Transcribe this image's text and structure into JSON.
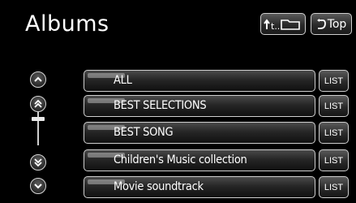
{
  "header": {
    "title": "Albums",
    "folder_button_icon": "folder-up-icon",
    "folder_button_label": "t..",
    "top_button_label": "Top",
    "top_button_icon": "return-arrow-icon"
  },
  "scroll": {
    "page_up_icon": "double-chevron-up-icon",
    "line_up_icon": "chevron-up-icon",
    "line_down_icon": "chevron-down-icon",
    "page_down_icon": "double-chevron-down-icon"
  },
  "albums": [
    {
      "label": "ALL",
      "list_label": "LIST"
    },
    {
      "label": "BEST SELECTIONS",
      "list_label": "LIST"
    },
    {
      "label": "BEST SONG",
      "list_label": "LIST"
    },
    {
      "label": "Children's Music collection",
      "list_label": "LIST"
    },
    {
      "label": "Movie soundtrack",
      "list_label": "LIST"
    }
  ]
}
